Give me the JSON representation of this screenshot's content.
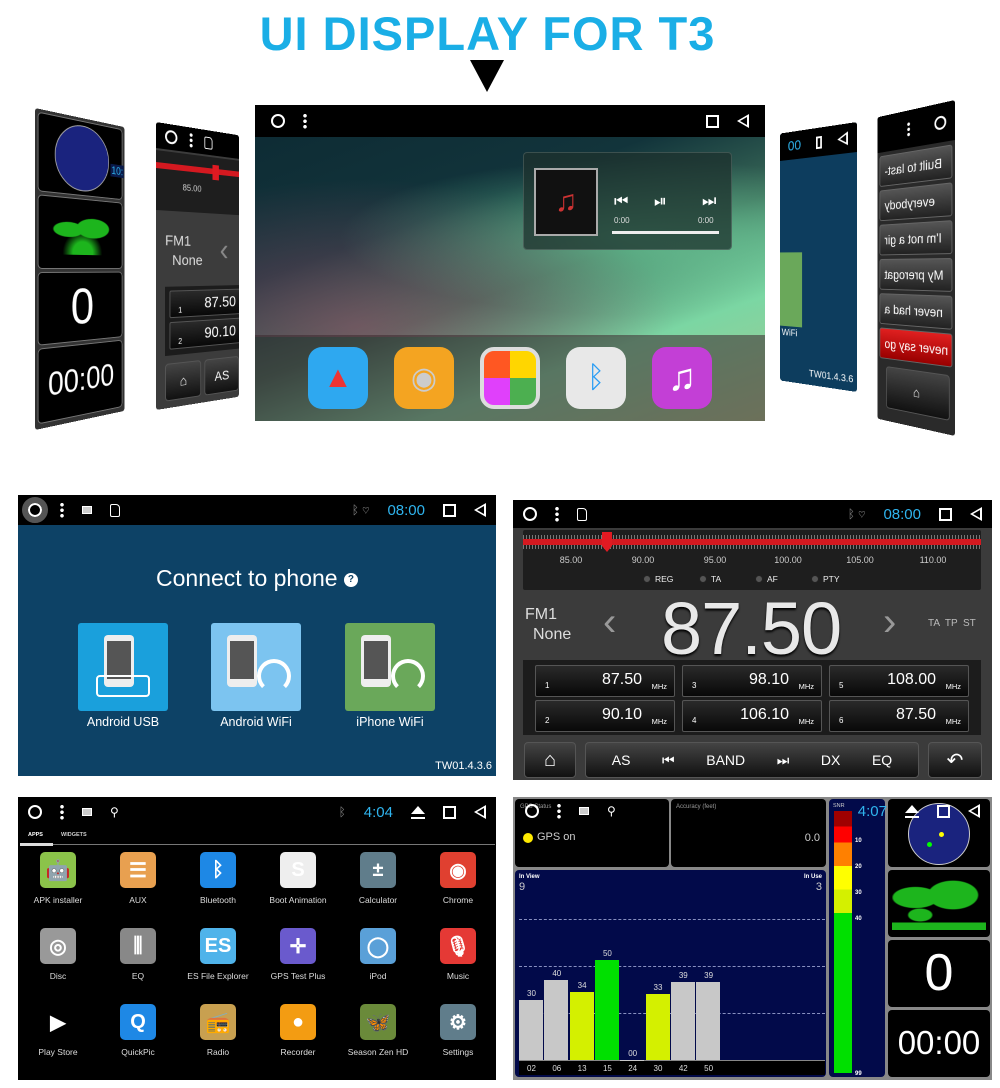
{
  "title": "UI DISPLAY FOR T3",
  "collage": {
    "center": {
      "widget": {
        "elapsed": "0:00",
        "duration": "0:00"
      },
      "dock": [
        {
          "name": "compass",
          "color": "#2ea8f0"
        },
        {
          "name": "speaker",
          "color": "#f4a421"
        },
        {
          "name": "grid",
          "color": "#eeeeee"
        },
        {
          "name": "bluetooth",
          "color": "#e8e8e8"
        },
        {
          "name": "music",
          "color": "#c33fd6"
        }
      ]
    },
    "left_gps": {
      "speed": "0",
      "time": "00:00",
      "clock_fragment": "10:"
    },
    "left_radio": {
      "scale": "85.00",
      "band": "FM1",
      "station": "None",
      "presets": [
        {
          "n": "1",
          "f": "87.50"
        },
        {
          "n": "2",
          "f": "90.10"
        }
      ],
      "as": "AS"
    },
    "right_connect": {
      "label_fragment": "WiFi",
      "version": "TW01.4.3.6",
      "time_fragment": "00"
    },
    "right_music": {
      "items": [
        "Built to last-",
        "everybody",
        "I'm not a gir",
        "My prerogat",
        "never had a",
        "never say go"
      ]
    }
  },
  "connect": {
    "time": "08:00",
    "heading": "Connect to phone",
    "help": "?",
    "tiles": [
      {
        "label": "Android USB",
        "color": "#1aa0dc"
      },
      {
        "label": "Android WiFi",
        "color": "#7cc4f0"
      },
      {
        "label": "iPhone WiFi",
        "color": "#6aa85a"
      }
    ],
    "version": "TW01.4.3.6"
  },
  "radio": {
    "time": "08:00",
    "scale": [
      "85.00",
      "90.00",
      "95.00",
      "100.00",
      "105.00",
      "110.00"
    ],
    "indicators": [
      "REG",
      "TA",
      "AF",
      "PTY"
    ],
    "band": "FM1",
    "station": "None",
    "frequency": "87.50",
    "flags": "TA  TP  ST",
    "prev": "‹",
    "next": "›",
    "presets": [
      {
        "n": "1",
        "f": "87.50",
        "u": "MHz"
      },
      {
        "n": "2",
        "f": "90.10",
        "u": "MHz"
      },
      {
        "n": "3",
        "f": "98.10",
        "u": "MHz"
      },
      {
        "n": "4",
        "f": "106.10",
        "u": "MHz"
      },
      {
        "n": "5",
        "f": "108.00",
        "u": "MHz"
      },
      {
        "n": "6",
        "f": "87.50",
        "u": "MHz"
      }
    ],
    "buttons": {
      "as": "AS",
      "band": "BAND",
      "dx": "DX",
      "eq": "EQ",
      "prev": "⏮",
      "next": "⏭",
      "home": "⌂",
      "back": "↶"
    }
  },
  "apps": {
    "time": "4:04",
    "tabs": [
      "APPS",
      "WIDGETS"
    ],
    "items": [
      {
        "label": "APK installer",
        "color": "#8bc34a",
        "glyph": "🤖"
      },
      {
        "label": "AUX",
        "color": "#e8a050",
        "glyph": "☰"
      },
      {
        "label": "Bluetooth",
        "color": "#1e88e5",
        "glyph": "ᛒ"
      },
      {
        "label": "Boot Animation",
        "color": "#eeeeee",
        "glyph": "S"
      },
      {
        "label": "Calculator",
        "color": "#607d8b",
        "glyph": "±"
      },
      {
        "label": "Chrome",
        "color": "#e04030",
        "glyph": "◉"
      },
      {
        "label": "Disc",
        "color": "#999999",
        "glyph": "◎"
      },
      {
        "label": "EQ",
        "color": "#888888",
        "glyph": "⫼"
      },
      {
        "label": "ES File Explorer",
        "color": "#4fb3ea",
        "glyph": "ES"
      },
      {
        "label": "GPS Test Plus",
        "color": "#6a5acd",
        "glyph": "✛"
      },
      {
        "label": "iPod",
        "color": "#5aa0d8",
        "glyph": "◯"
      },
      {
        "label": "Music",
        "color": "#e53935",
        "glyph": "🎙"
      },
      {
        "label": "Play Store",
        "color": "#000000",
        "glyph": "▶"
      },
      {
        "label": "QuickPic",
        "color": "#1e88e5",
        "glyph": "Q"
      },
      {
        "label": "Radio",
        "color": "#c8a050",
        "glyph": "📻"
      },
      {
        "label": "Recorder",
        "color": "#f39c12",
        "glyph": "●"
      },
      {
        "label": "Season Zen HD",
        "color": "#6a8a3a",
        "glyph": "🦋"
      },
      {
        "label": "Settings",
        "color": "#607d8b",
        "glyph": "⚙"
      }
    ]
  },
  "gps": {
    "time": "4:07",
    "status_label": "GPS Status",
    "status": "GPS on",
    "accuracy_label": "Accuracy (feet)",
    "accuracy": "0.0",
    "in_view_label": "In View",
    "in_view": "9",
    "in_use_label": "In Use",
    "in_use": "3",
    "snr_label": "SNR",
    "snr_ticks": [
      "10",
      "20",
      "30",
      "40",
      "99"
    ],
    "satellites": [
      {
        "prn": "02",
        "snr": 30,
        "color": "#c8c8c8"
      },
      {
        "prn": "06",
        "snr": 40,
        "color": "#c8c8c8"
      },
      {
        "prn": "13",
        "snr": 34,
        "color": "#d4f000"
      },
      {
        "prn": "15",
        "snr": 50,
        "color": "#00e000"
      },
      {
        "prn": "24",
        "snr": 0,
        "label": "00",
        "color": "#c8c8c8"
      },
      {
        "prn": "30",
        "snr": 33,
        "color": "#d4f000"
      },
      {
        "prn": "42",
        "snr": 39,
        "color": "#c8c8c8"
      },
      {
        "prn": "50",
        "snr": 39,
        "color": "#c8c8c8"
      }
    ],
    "speed": "0",
    "timer": "00:00"
  }
}
